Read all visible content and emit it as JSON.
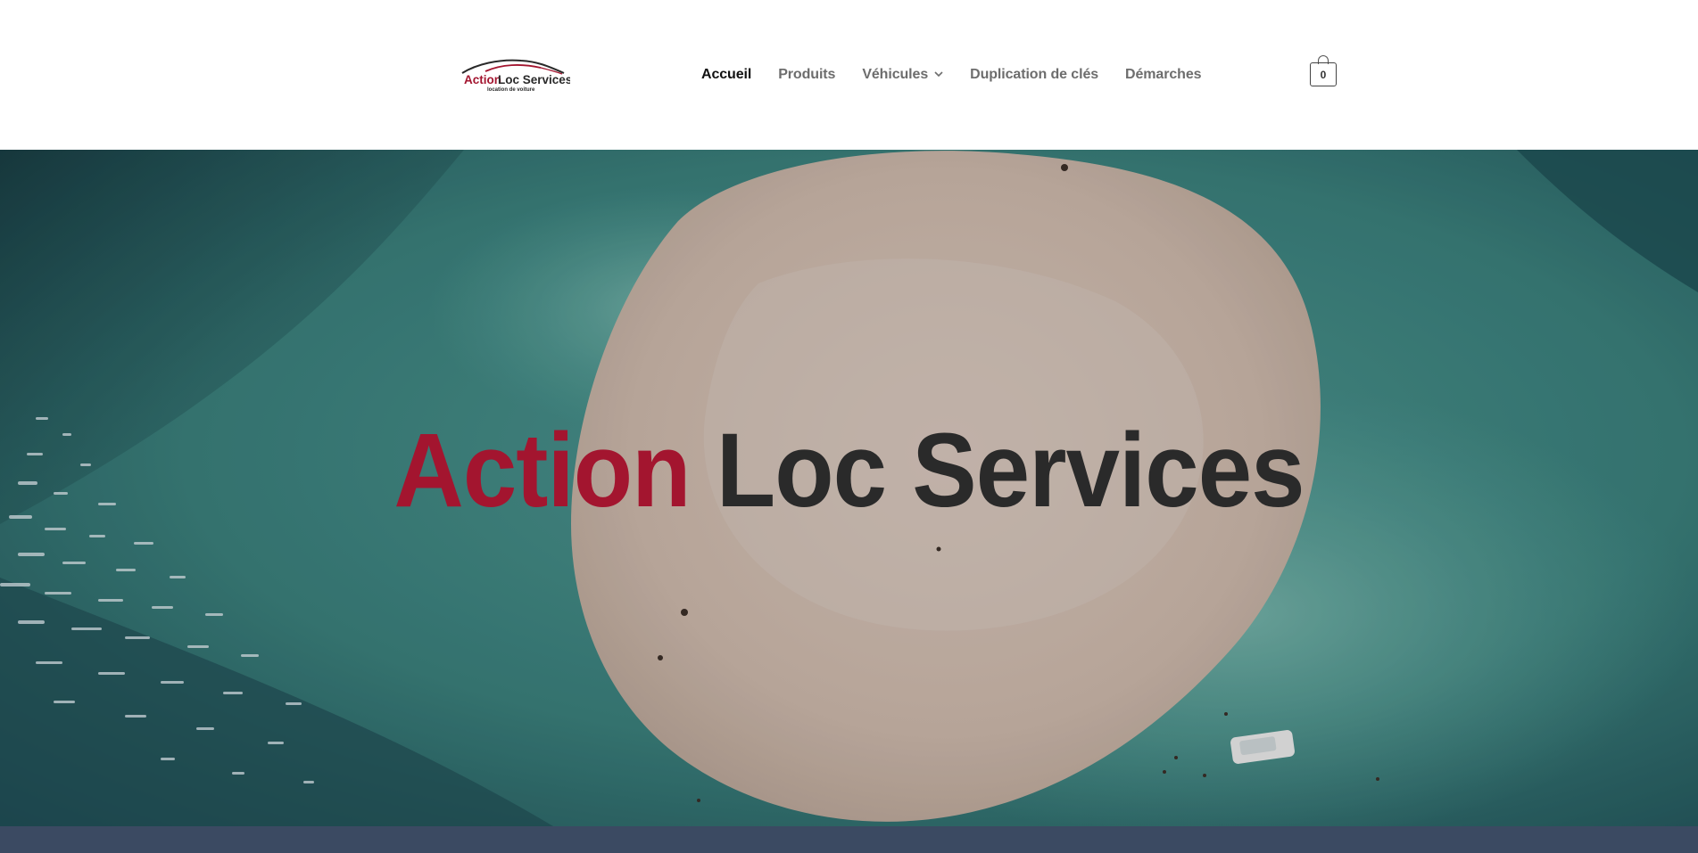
{
  "brand": {
    "logo_word_1": "Action",
    "logo_word_2": "Loc Services",
    "logo_tagline": "location de voiture",
    "accent_color": "#a3152f",
    "dark_color": "#2a2a2a"
  },
  "nav": {
    "items": [
      {
        "label": "Accueil",
        "active": true
      },
      {
        "label": "Produits",
        "active": false
      },
      {
        "label": "Véhicules",
        "active": false,
        "has_dropdown": true
      },
      {
        "label": "Duplication de clés",
        "active": false
      },
      {
        "label": "Démarches",
        "active": false
      }
    ]
  },
  "cart": {
    "count": "0",
    "icon": "shopping-bag-icon"
  },
  "hero": {
    "title_red": "Action",
    "title_dark": "Loc Services"
  },
  "footer_strip": {
    "color": "#3b4a62"
  }
}
